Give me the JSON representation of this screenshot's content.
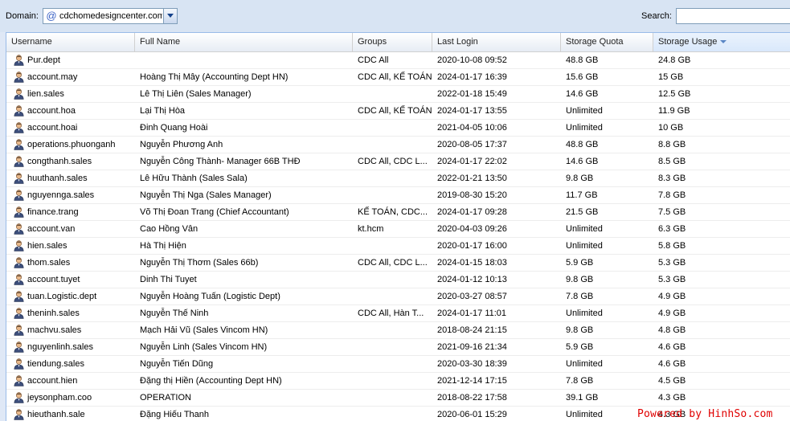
{
  "toolbar": {
    "domain_label": "Domain:",
    "domain_value": "cdchomedesigncenter.com",
    "search_label": "Search:",
    "search_value": ""
  },
  "grid": {
    "columns": [
      "Username",
      "Full Name",
      "Groups",
      "Last Login",
      "Storage Quota",
      "Storage Usage"
    ],
    "sorted_column": "Storage Usage",
    "sort_direction": "descending",
    "rows": [
      {
        "username": "Pur.dept",
        "full_name": "",
        "groups": "CDC All",
        "last_login": "2020-10-08 09:52",
        "quota": "48.8 GB",
        "usage": "24.8 GB"
      },
      {
        "username": "account.may",
        "full_name": "Hoàng Thị Mây (Accounting Dept HN)",
        "groups": "CDC All, KẾ TOÁN",
        "last_login": "2024-01-17 16:39",
        "quota": "15.6 GB",
        "usage": "15 GB"
      },
      {
        "username": "lien.sales",
        "full_name": "Lê Thị Liên (Sales Manager)",
        "groups": "",
        "last_login": "2022-01-18 15:49",
        "quota": "14.6 GB",
        "usage": "12.5 GB"
      },
      {
        "username": "account.hoa",
        "full_name": "Lại Thị Hòa",
        "groups": "CDC All, KẾ TOÁN",
        "last_login": "2024-01-17 13:55",
        "quota": "Unlimited",
        "usage": "11.9 GB"
      },
      {
        "username": "account.hoai",
        "full_name": "Đinh Quang Hoài",
        "groups": "",
        "last_login": "2021-04-05 10:06",
        "quota": "Unlimited",
        "usage": "10 GB"
      },
      {
        "username": "operations.phuonganh",
        "full_name": "Nguyễn Phương Anh",
        "groups": "",
        "last_login": "2020-08-05 17:37",
        "quota": "48.8 GB",
        "usage": "8.8 GB"
      },
      {
        "username": "congthanh.sales",
        "full_name": "Nguyễn Công Thành- Manager 66B THĐ",
        "groups": "CDC All, CDC L...",
        "last_login": "2024-01-17 22:02",
        "quota": "14.6 GB",
        "usage": "8.5 GB"
      },
      {
        "username": "huuthanh.sales",
        "full_name": "Lê Hữu Thành (Sales Sala)",
        "groups": "",
        "last_login": "2022-01-21 13:50",
        "quota": "9.8 GB",
        "usage": "8.3 GB"
      },
      {
        "username": "nguyennga.sales",
        "full_name": "Nguyễn Thị Nga (Sales Manager)",
        "groups": "",
        "last_login": "2019-08-30 15:20",
        "quota": "11.7 GB",
        "usage": "7.8 GB"
      },
      {
        "username": "finance.trang",
        "full_name": "Võ Thị Đoan Trang (Chief Accountant)",
        "groups": "KẾ TOÁN, CDC...",
        "last_login": "2024-01-17 09:28",
        "quota": "21.5 GB",
        "usage": "7.5 GB"
      },
      {
        "username": "account.van",
        "full_name": "Cao Hồng Vân",
        "groups": "kt.hcm",
        "last_login": "2020-04-03 09:26",
        "quota": "Unlimited",
        "usage": "6.3 GB"
      },
      {
        "username": "hien.sales",
        "full_name": "Hà Thị Hiện",
        "groups": "",
        "last_login": "2020-01-17 16:00",
        "quota": "Unlimited",
        "usage": "5.8 GB"
      },
      {
        "username": "thom.sales",
        "full_name": "Nguyễn Thị Thơm (Sales 66b)",
        "groups": "CDC All, CDC L...",
        "last_login": "2024-01-15 18:03",
        "quota": "5.9 GB",
        "usage": "5.3 GB"
      },
      {
        "username": "account.tuyet",
        "full_name": "Dinh Thi Tuyet",
        "groups": "",
        "last_login": "2024-01-12 10:13",
        "quota": "9.8 GB",
        "usage": "5.3 GB"
      },
      {
        "username": "tuan.Logistic.dept",
        "full_name": "Nguyễn Hoàng Tuấn (Logistic Dept)",
        "groups": "",
        "last_login": "2020-03-27 08:57",
        "quota": "7.8 GB",
        "usage": "4.9 GB"
      },
      {
        "username": "theninh.sales",
        "full_name": "Nguyễn Thế Ninh",
        "groups": "CDC All, Hàn T...",
        "last_login": "2024-01-17 11:01",
        "quota": "Unlimited",
        "usage": "4.9 GB"
      },
      {
        "username": "machvu.sales",
        "full_name": "Mạch Hải Vũ (Sales Vincom HN)",
        "groups": "",
        "last_login": "2018-08-24 21:15",
        "quota": "9.8 GB",
        "usage": "4.8 GB"
      },
      {
        "username": "nguyenlinh.sales",
        "full_name": "Nguyễn Linh (Sales Vincom HN)",
        "groups": "",
        "last_login": "2021-09-16 21:34",
        "quota": "5.9 GB",
        "usage": "4.6 GB"
      },
      {
        "username": "tiendung.sales",
        "full_name": "Nguyễn Tiến Dũng",
        "groups": "",
        "last_login": "2020-03-30 18:39",
        "quota": "Unlimited",
        "usage": "4.6 GB"
      },
      {
        "username": "account.hien",
        "full_name": "Đặng thị Hiền (Accounting Dept HN)",
        "groups": "",
        "last_login": "2021-12-14 17:15",
        "quota": "7.8 GB",
        "usage": "4.5 GB"
      },
      {
        "username": "jeysonpham.coo",
        "full_name": "OPERATION",
        "groups": "",
        "last_login": "2018-08-22 17:58",
        "quota": "39.1 GB",
        "usage": "4.3 GB"
      },
      {
        "username": "hieuthanh.sale",
        "full_name": "Đặng Hiếu Thanh",
        "groups": "",
        "last_login": "2020-06-01 15:29",
        "quota": "Unlimited",
        "usage": "4.3 GB"
      }
    ]
  },
  "watermark": "Powered by HinhSo.com"
}
